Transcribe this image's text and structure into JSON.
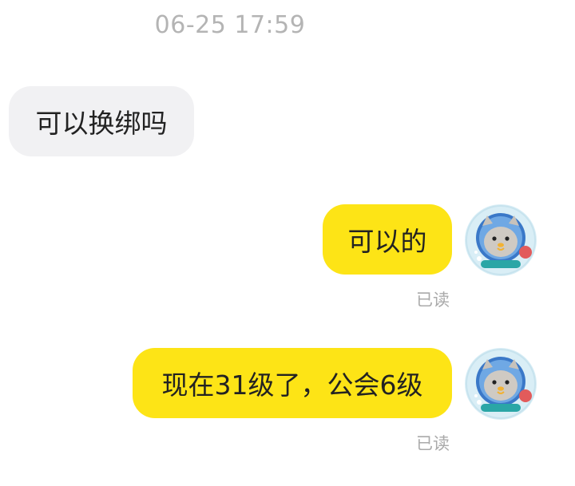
{
  "timestamp": "06-25 17:59",
  "messages": [
    {
      "direction": "incoming",
      "text": "可以换绑吗"
    },
    {
      "direction": "outgoing",
      "text": "可以的",
      "status": "已读"
    },
    {
      "direction": "outgoing",
      "text": "现在31级了，公会6级",
      "status": "已读"
    }
  ],
  "colors": {
    "outgoing_bubble": "#fde416",
    "incoming_bubble": "#f1f1f3",
    "status_text": "#aaaaaa",
    "timestamp_text": "#b4b4b4"
  },
  "avatar_icon": "seal-in-helmet-avatar"
}
